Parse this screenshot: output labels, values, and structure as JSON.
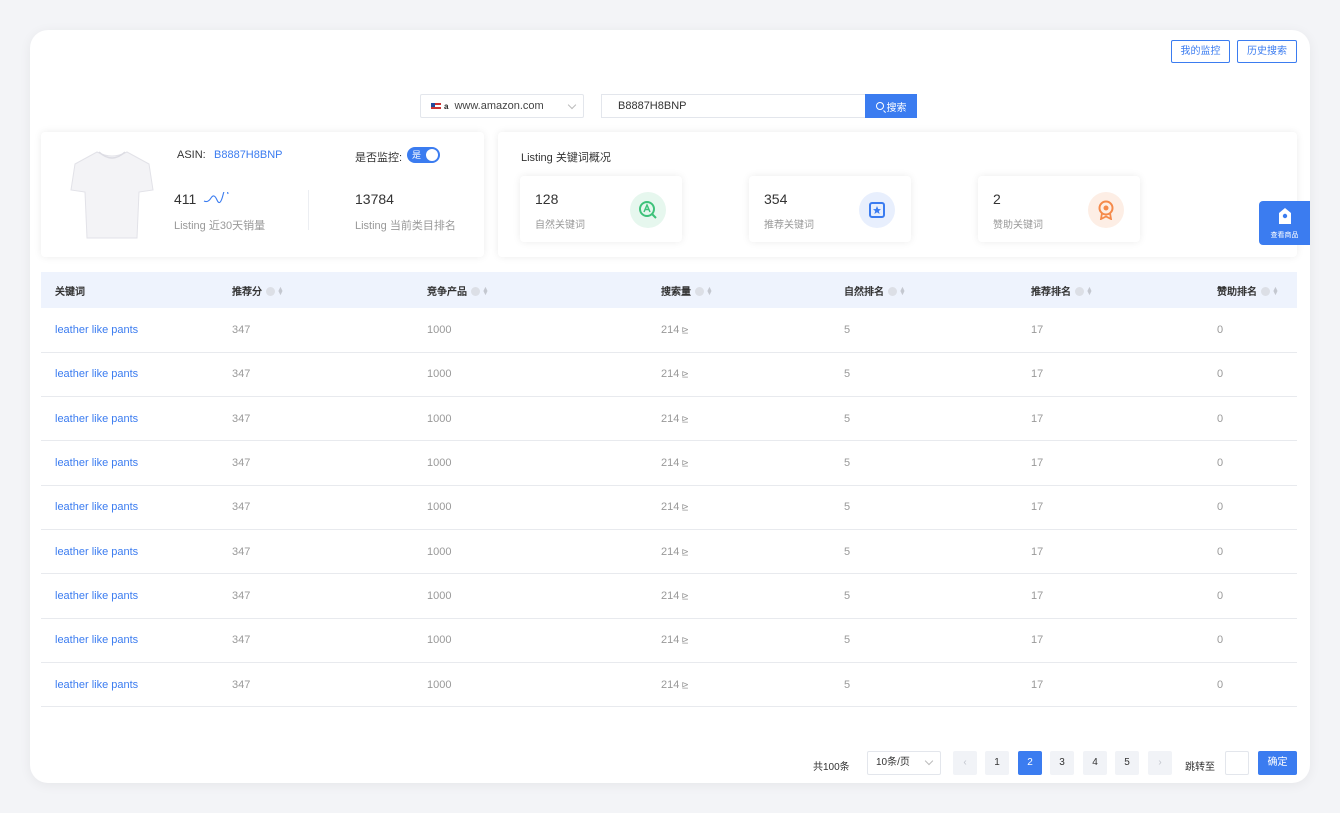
{
  "header": {
    "my_monitor": "我的监控",
    "history_search": "历史搜索"
  },
  "search": {
    "site": "www.amazon.com",
    "site_brand": "a",
    "query": "B8887H8BNP",
    "button": "搜索"
  },
  "product": {
    "asin_label": "ASIN:",
    "asin": "B8887H8BNP",
    "monitor_label": "是否监控:",
    "monitor_toggle": "是",
    "sales": "411",
    "sales_label": "Listing 近30天销量",
    "rank": "13784",
    "rank_label": "Listing 当前类目排名"
  },
  "overview": {
    "title": "Listing 关键词概况",
    "cards": [
      {
        "value": "128",
        "label": "自然关键词",
        "icon": "natural-keyword-icon",
        "color": "#3ec27a"
      },
      {
        "value": "354",
        "label": "推荐关键词",
        "icon": "star-badge-icon",
        "color": "#3b7cf0"
      },
      {
        "value": "2",
        "label": "赞助关键词",
        "icon": "award-icon",
        "color": "#f58a4b"
      }
    ]
  },
  "side_float": {
    "label": "查看商品"
  },
  "table": {
    "columns": [
      "关键词",
      "推荐分",
      "竞争产品",
      "搜索量",
      "自然排名",
      "推荐排名",
      "赞助排名"
    ],
    "rows": [
      [
        "leather like pants",
        "347",
        "1000",
        "214",
        "5",
        "17",
        "0"
      ],
      [
        "leather like pants",
        "347",
        "1000",
        "214",
        "5",
        "17",
        "0"
      ],
      [
        "leather like pants",
        "347",
        "1000",
        "214",
        "5",
        "17",
        "0"
      ],
      [
        "leather like pants",
        "347",
        "1000",
        "214",
        "5",
        "17",
        "0"
      ],
      [
        "leather like pants",
        "347",
        "1000",
        "214",
        "5",
        "17",
        "0"
      ],
      [
        "leather like pants",
        "347",
        "1000",
        "214",
        "5",
        "17",
        "0"
      ],
      [
        "leather like pants",
        "347",
        "1000",
        "214",
        "5",
        "17",
        "0"
      ],
      [
        "leather like pants",
        "347",
        "1000",
        "214",
        "5",
        "17",
        "0"
      ],
      [
        "leather like pants",
        "347",
        "1000",
        "214",
        "5",
        "17",
        "0"
      ]
    ]
  },
  "pagination": {
    "total": "共100条",
    "page_size": "10条/页",
    "pages": [
      "1",
      "2",
      "3",
      "4",
      "5"
    ],
    "current": "2",
    "prev": "‹",
    "next": "›",
    "jump_label": "跳转至",
    "confirm": "确定"
  }
}
